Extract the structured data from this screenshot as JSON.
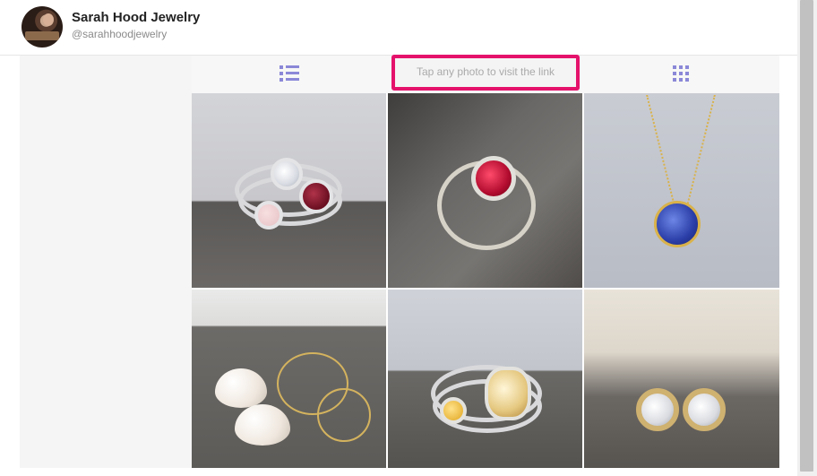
{
  "profile": {
    "name": "Sarah Hood Jewelry",
    "handle": "@sarahhoodjewelry"
  },
  "toolbar": {
    "hint": "Tap any photo to visit the link",
    "list_view_icon": "list-icon",
    "grid_view_icon": "grid-icon",
    "accent_color": "#8b88d8",
    "highlight_color": "#e5126b"
  },
  "photos": [
    {
      "subject": "stacked silver rings with white, garnet and rose quartz stones"
    },
    {
      "subject": "silver ring with round red garnet"
    },
    {
      "subject": "gold chain necklace with blue sapphire pendant"
    },
    {
      "subject": "gold hoop earrings with pearl drops"
    },
    {
      "subject": "stacked rings with citrine and rutilated quartz"
    },
    {
      "subject": "gold bezel stud earrings with white stones"
    }
  ]
}
